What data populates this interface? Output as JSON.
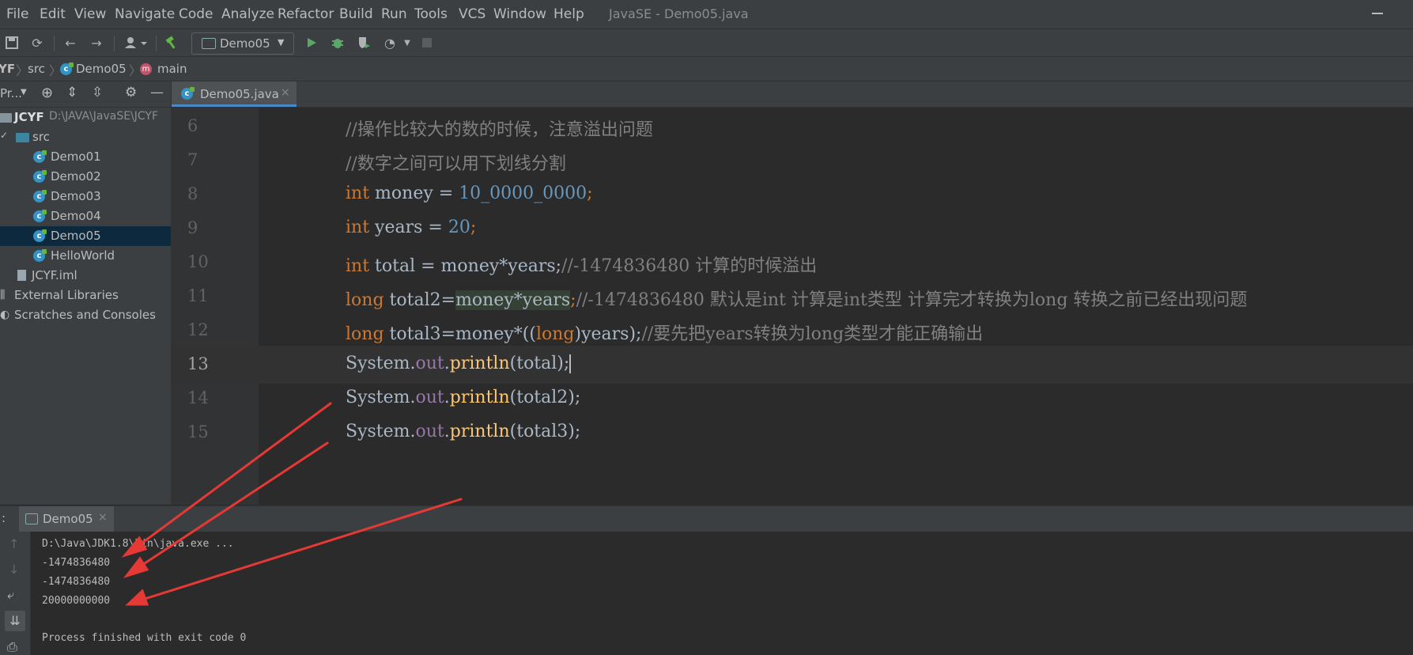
{
  "menu": {
    "items": [
      "File",
      "Edit",
      "View",
      "Navigate",
      "Code",
      "Analyze",
      "Refactor",
      "Build",
      "Run",
      "Tools",
      "VCS",
      "Window",
      "Help"
    ],
    "window_title": "JavaSE - Demo05.java"
  },
  "toolbar": {
    "run_config": "Demo05"
  },
  "breadcrumbs": [
    "YF",
    "src",
    "Demo05",
    "main"
  ],
  "project": {
    "header_label": "Pr...",
    "root_name": "JCYF",
    "root_path": "D:\\JAVA\\JavaSE\\JCYF",
    "src_label": "src",
    "classes": [
      "Demo01",
      "Demo02",
      "Demo03",
      "Demo04",
      "Demo05",
      "HelloWorld"
    ],
    "selected_class": "Demo05",
    "iml_file": "JCYF.iml",
    "external_libraries": "External Libraries",
    "scratches": "Scratches and Consoles"
  },
  "editor": {
    "tab_label": "Demo05.java",
    "line_numbers": [
      "6",
      "7",
      "8",
      "9",
      "10",
      "11",
      "12",
      "13",
      "14",
      "15"
    ],
    "lines": {
      "l6_comment": "//操作比较大的数的时候，注意溢出问题",
      "l7_comment": "//数字之间可以用下划线分割",
      "l8_kw": "int",
      "l8_var": " money = ",
      "l8_num": "10_0000_0000",
      "l8_end": ";",
      "l9_kw": "int",
      "l9_var": " years = ",
      "l9_num": "20",
      "l9_end": ";",
      "l10_kw": "int",
      "l10_code": " total = money*years;",
      "l10_comment": "//-1474836480 计算的时候溢出",
      "l11_kw": "long",
      "l11_code_a": " total2=",
      "l11_code_hl": "money*years",
      "l11_code_b": ";",
      "l11_comment": "//-1474836480 默认是int 计算是int类型 计算完才转换为long 转换之前已经出现问题",
      "l12_kw": "long",
      "l12_code_a": " total3=money*((",
      "l12_kw2": "long",
      "l12_code_b": ")years);",
      "l12_comment": "//要先把years转换为long类型才能正确输出",
      "l13_sys": "System.",
      "l13_out": "out",
      "l13_dot": ".",
      "l13_m": "println",
      "l13_args": "(total);",
      "l14_sys": "System.",
      "l14_out": "out",
      "l14_dot": ".",
      "l14_m": "println",
      "l14_args": "(total2);",
      "l15_sys": "System.",
      "l15_out": "out",
      "l15_dot": ".",
      "l15_m": "println",
      "l15_args": "(total3);"
    }
  },
  "run_panel": {
    "prefix": ":",
    "tab_label": "Demo05",
    "console_lines": [
      "D:\\Java\\JDK1.8\\bin\\java.exe ...",
      "-1474836480",
      "-1474836480",
      "20000000000",
      "",
      "Process finished with exit code 0"
    ]
  },
  "colors": {
    "keyword": "#cc7832",
    "number": "#6897bb",
    "comment": "#808080",
    "field": "#9876aa",
    "method": "#ffc66d",
    "annotation_arrow": "#e53935"
  }
}
